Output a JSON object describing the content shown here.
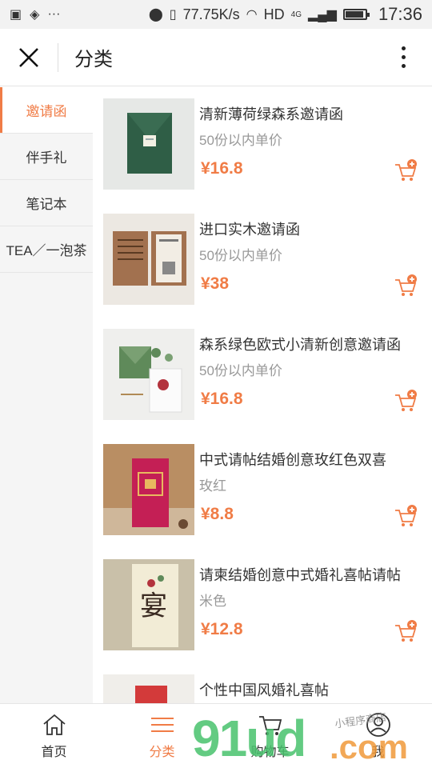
{
  "status_bar": {
    "speed": "77.75K/s",
    "network": "HD",
    "signal": "4G",
    "time": "17:36"
  },
  "header": {
    "title": "分类"
  },
  "sidebar": {
    "items": [
      {
        "label": "邀请函",
        "active": true
      },
      {
        "label": "伴手礼",
        "active": false
      },
      {
        "label": "笔记本",
        "active": false
      },
      {
        "label": "TEA／一泡茶",
        "active": false
      }
    ]
  },
  "products": [
    {
      "name": "清新薄荷绿森系邀请函",
      "desc": "50份以内单价",
      "price": "¥16.8"
    },
    {
      "name": "进口实木邀请函",
      "desc": "50份以内单价",
      "price": "¥38"
    },
    {
      "name": "森系绿色欧式小清新创意邀请函",
      "desc": "50份以内单价",
      "price": "¥16.8"
    },
    {
      "name": "中式请帖结婚创意玫红色双喜",
      "desc": "玫红",
      "price": "¥8.8"
    },
    {
      "name": "请柬结婚创意中式婚礼喜帖请帖",
      "desc": "米色",
      "price": "¥12.8"
    },
    {
      "name": "个性中国风婚礼喜帖",
      "desc": "",
      "price": ""
    }
  ],
  "bottom_nav": {
    "home": "首页",
    "category": "分类",
    "cart": "购物车",
    "me": "我"
  },
  "watermark": {
    "main": "91ud",
    "com": ".com",
    "sub": "小程序商店"
  },
  "colors": {
    "accent": "#f07c46",
    "sidebar_bg": "#f5f5f5"
  }
}
